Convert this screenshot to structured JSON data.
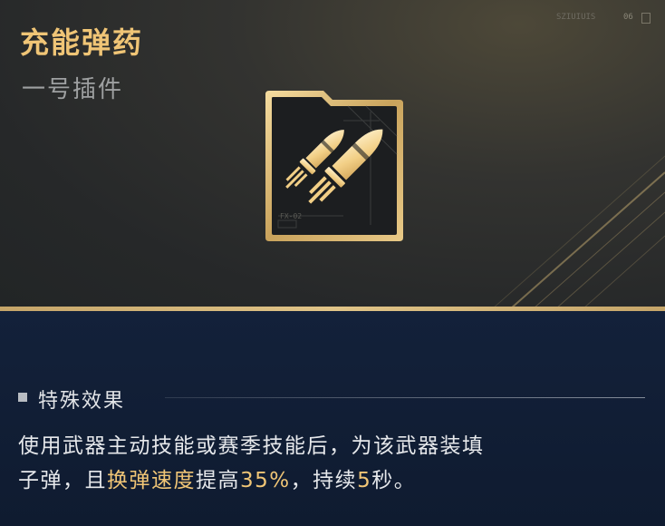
{
  "item": {
    "name": "充能弹药",
    "type": "一号插件",
    "corner_code": "SZIUIUIS",
    "corner_num": "06",
    "icon": "twin-bullets-icon",
    "frame_small_text": "FX-02"
  },
  "effect": {
    "section_title": "特殊效果",
    "line1": "使用武器主动技能或赛季技能后，为该武器装填",
    "line2_a": "子弹，且",
    "line2_hl_stat": "换弹速度",
    "line2_b": "提高",
    "line2_hl_pct": "35%",
    "line2_c": "，持续",
    "line2_hl_sec": "5",
    "line2_d": "秒。"
  },
  "colors": {
    "accent_gold": "#f0c576",
    "top_panel": "#2b2c2d",
    "bottom_panel": "#13213a",
    "text_light": "#e6e8eb",
    "text_muted": "#9ea0a1"
  }
}
